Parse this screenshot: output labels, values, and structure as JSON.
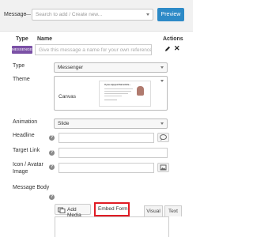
{
  "top": {
    "label": "Message",
    "dash": "—",
    "select_placeholder": "Search to add / Create new...",
    "preview_label": "Preview"
  },
  "header": {
    "type": "Type",
    "name": "Name",
    "actions": "Actions"
  },
  "message": {
    "badge": "MESSENGER",
    "name_placeholder": "Give this message a name for your own reference",
    "close_glyph": "✕"
  },
  "fields": {
    "type_label": "Type",
    "type_value": "Messenger",
    "theme_label": "Theme",
    "theme_value": "Canvas",
    "theme_thumb_title": "If you enjoyed that article...",
    "animation_label": "Animation",
    "animation_value": "Slide",
    "headline_label": "Headline",
    "target_label": "Target Link",
    "icon_label_1": "Icon / Avatar",
    "icon_label_2": "Image",
    "body_label": "Message Body",
    "help_glyph": "?"
  },
  "editor": {
    "add_media": "Add Media",
    "embed_form": "Embed Form",
    "visual_tab": "Visual",
    "text_tab": "Text"
  },
  "colors": {
    "preview": "#2d8ac7",
    "badge": "#7b51a6",
    "highlight": "#e01b24"
  }
}
